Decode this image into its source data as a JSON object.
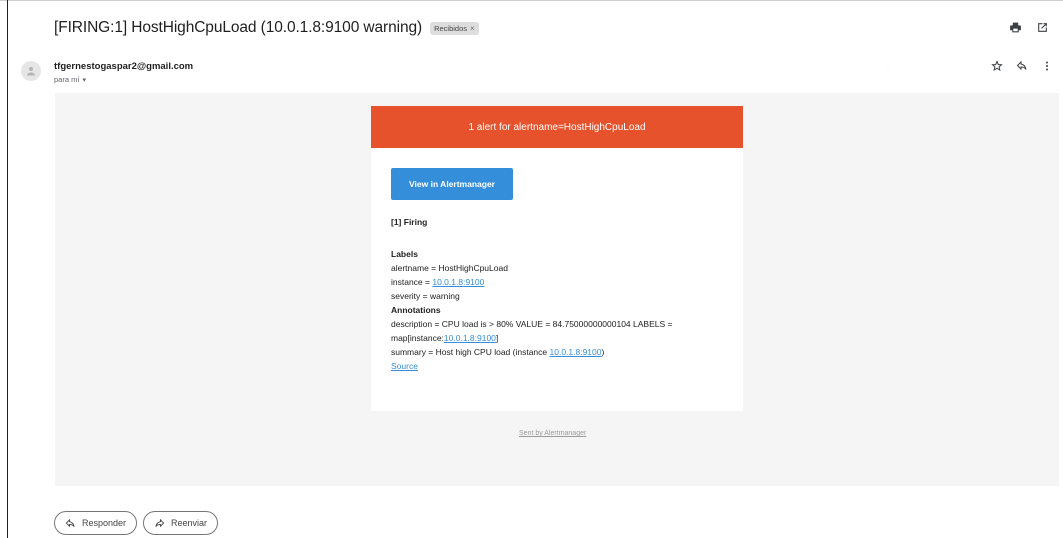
{
  "email": {
    "subject": "[FIRING:1] HostHighCpuLoad (10.0.1.8:9100 warning)",
    "label": "Recibidos",
    "label_close": "×",
    "sender": "tfgernestogaspar2@gmail.com",
    "recipient": "para mí",
    "recipient_caret": "▾",
    "faint_time": "· ·"
  },
  "icons": {
    "print": "print-icon",
    "open_new_window": "open-in-new-icon",
    "star": "star-icon",
    "reply": "reply-icon",
    "more": "more-vert-icon"
  },
  "alert": {
    "header": "1 alert for alertname=HostHighCpuLoad",
    "header_color": "#e6522c",
    "button_label": "View in Alertmanager",
    "button_color": "#348eda",
    "firing_title": "[1] Firing",
    "labels_title": "Labels",
    "label_alertname": "alertname = HostHighCpuLoad",
    "label_instance_prefix": "instance = ",
    "label_instance_link": "10.0.1.8:9100",
    "label_severity": "severity = warning",
    "annotations_title": "Annotations",
    "desc_line1": "description = CPU load is > 80% VALUE = 84.75000000000104 LABELS =",
    "desc_line2_prefix": "map[instance:",
    "desc_line2_link": "10.0.1.8:9100",
    "desc_line2_suffix": "]",
    "summary_prefix": "summary = Host high CPU load (instance ",
    "summary_link": "10.0.1.8:9100",
    "summary_suffix": ")",
    "source_link": "Source",
    "footer": "Sent by Alertmanager"
  },
  "actions": {
    "reply": "Responder",
    "forward": "Reenviar"
  }
}
